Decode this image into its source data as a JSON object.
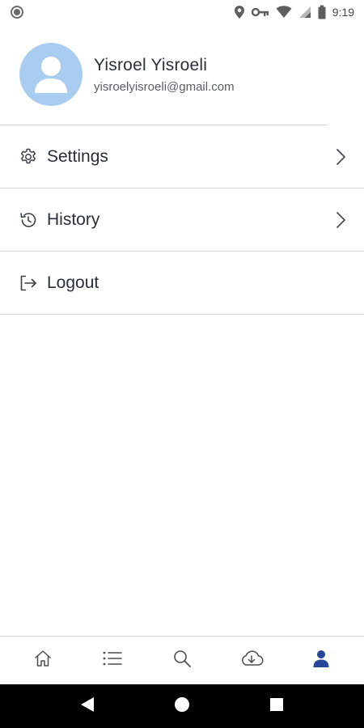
{
  "status_bar": {
    "time": "9:19",
    "icons": [
      "record-dot-icon",
      "location-icon",
      "vpn-key-icon",
      "wifi-icon",
      "cell-signal-icon",
      "battery-icon"
    ]
  },
  "profile": {
    "name": "Yisroel Yisroeli",
    "email": "yisroelyisroeli@gmail.com",
    "avatar_color": "#a9cdf0"
  },
  "menu": {
    "items": [
      {
        "label": "Settings",
        "icon": "gear-icon",
        "has_chevron": true
      },
      {
        "label": "History",
        "icon": "history-icon",
        "has_chevron": true
      },
      {
        "label": "Logout",
        "icon": "logout-icon",
        "has_chevron": false
      }
    ]
  },
  "bottom_nav": {
    "items": [
      "home-icon",
      "list-icon",
      "search-icon",
      "cloud-download-icon",
      "profile-icon"
    ],
    "active": "profile-icon",
    "active_color": "#25479a",
    "inactive_color": "#4d4d4d"
  },
  "system_nav": {
    "buttons": [
      "back-icon",
      "home-circle-icon",
      "recents-icon"
    ]
  }
}
